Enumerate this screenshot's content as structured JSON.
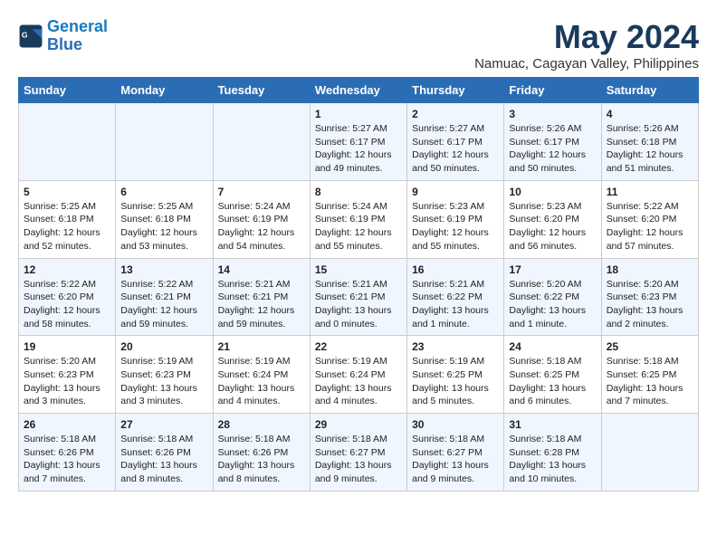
{
  "logo": {
    "line1": "General",
    "line2": "Blue"
  },
  "title": "May 2024",
  "subtitle": "Namuac, Cagayan Valley, Philippines",
  "headers": [
    "Sunday",
    "Monday",
    "Tuesday",
    "Wednesday",
    "Thursday",
    "Friday",
    "Saturday"
  ],
  "weeks": [
    [
      {
        "day": "",
        "info": ""
      },
      {
        "day": "",
        "info": ""
      },
      {
        "day": "",
        "info": ""
      },
      {
        "day": "1",
        "sunrise": "Sunrise: 5:27 AM",
        "sunset": "Sunset: 6:17 PM",
        "daylight": "Daylight: 12 hours and 49 minutes."
      },
      {
        "day": "2",
        "sunrise": "Sunrise: 5:27 AM",
        "sunset": "Sunset: 6:17 PM",
        "daylight": "Daylight: 12 hours and 50 minutes."
      },
      {
        "day": "3",
        "sunrise": "Sunrise: 5:26 AM",
        "sunset": "Sunset: 6:17 PM",
        "daylight": "Daylight: 12 hours and 50 minutes."
      },
      {
        "day": "4",
        "sunrise": "Sunrise: 5:26 AM",
        "sunset": "Sunset: 6:18 PM",
        "daylight": "Daylight: 12 hours and 51 minutes."
      }
    ],
    [
      {
        "day": "5",
        "sunrise": "Sunrise: 5:25 AM",
        "sunset": "Sunset: 6:18 PM",
        "daylight": "Daylight: 12 hours and 52 minutes."
      },
      {
        "day": "6",
        "sunrise": "Sunrise: 5:25 AM",
        "sunset": "Sunset: 6:18 PM",
        "daylight": "Daylight: 12 hours and 53 minutes."
      },
      {
        "day": "7",
        "sunrise": "Sunrise: 5:24 AM",
        "sunset": "Sunset: 6:19 PM",
        "daylight": "Daylight: 12 hours and 54 minutes."
      },
      {
        "day": "8",
        "sunrise": "Sunrise: 5:24 AM",
        "sunset": "Sunset: 6:19 PM",
        "daylight": "Daylight: 12 hours and 55 minutes."
      },
      {
        "day": "9",
        "sunrise": "Sunrise: 5:23 AM",
        "sunset": "Sunset: 6:19 PM",
        "daylight": "Daylight: 12 hours and 55 minutes."
      },
      {
        "day": "10",
        "sunrise": "Sunrise: 5:23 AM",
        "sunset": "Sunset: 6:20 PM",
        "daylight": "Daylight: 12 hours and 56 minutes."
      },
      {
        "day": "11",
        "sunrise": "Sunrise: 5:22 AM",
        "sunset": "Sunset: 6:20 PM",
        "daylight": "Daylight: 12 hours and 57 minutes."
      }
    ],
    [
      {
        "day": "12",
        "sunrise": "Sunrise: 5:22 AM",
        "sunset": "Sunset: 6:20 PM",
        "daylight": "Daylight: 12 hours and 58 minutes."
      },
      {
        "day": "13",
        "sunrise": "Sunrise: 5:22 AM",
        "sunset": "Sunset: 6:21 PM",
        "daylight": "Daylight: 12 hours and 59 minutes."
      },
      {
        "day": "14",
        "sunrise": "Sunrise: 5:21 AM",
        "sunset": "Sunset: 6:21 PM",
        "daylight": "Daylight: 12 hours and 59 minutes."
      },
      {
        "day": "15",
        "sunrise": "Sunrise: 5:21 AM",
        "sunset": "Sunset: 6:21 PM",
        "daylight": "Daylight: 13 hours and 0 minutes."
      },
      {
        "day": "16",
        "sunrise": "Sunrise: 5:21 AM",
        "sunset": "Sunset: 6:22 PM",
        "daylight": "Daylight: 13 hours and 1 minute."
      },
      {
        "day": "17",
        "sunrise": "Sunrise: 5:20 AM",
        "sunset": "Sunset: 6:22 PM",
        "daylight": "Daylight: 13 hours and 1 minute."
      },
      {
        "day": "18",
        "sunrise": "Sunrise: 5:20 AM",
        "sunset": "Sunset: 6:23 PM",
        "daylight": "Daylight: 13 hours and 2 minutes."
      }
    ],
    [
      {
        "day": "19",
        "sunrise": "Sunrise: 5:20 AM",
        "sunset": "Sunset: 6:23 PM",
        "daylight": "Daylight: 13 hours and 3 minutes."
      },
      {
        "day": "20",
        "sunrise": "Sunrise: 5:19 AM",
        "sunset": "Sunset: 6:23 PM",
        "daylight": "Daylight: 13 hours and 3 minutes."
      },
      {
        "day": "21",
        "sunrise": "Sunrise: 5:19 AM",
        "sunset": "Sunset: 6:24 PM",
        "daylight": "Daylight: 13 hours and 4 minutes."
      },
      {
        "day": "22",
        "sunrise": "Sunrise: 5:19 AM",
        "sunset": "Sunset: 6:24 PM",
        "daylight": "Daylight: 13 hours and 4 minutes."
      },
      {
        "day": "23",
        "sunrise": "Sunrise: 5:19 AM",
        "sunset": "Sunset: 6:25 PM",
        "daylight": "Daylight: 13 hours and 5 minutes."
      },
      {
        "day": "24",
        "sunrise": "Sunrise: 5:18 AM",
        "sunset": "Sunset: 6:25 PM",
        "daylight": "Daylight: 13 hours and 6 minutes."
      },
      {
        "day": "25",
        "sunrise": "Sunrise: 5:18 AM",
        "sunset": "Sunset: 6:25 PM",
        "daylight": "Daylight: 13 hours and 7 minutes."
      }
    ],
    [
      {
        "day": "26",
        "sunrise": "Sunrise: 5:18 AM",
        "sunset": "Sunset: 6:26 PM",
        "daylight": "Daylight: 13 hours and 7 minutes."
      },
      {
        "day": "27",
        "sunrise": "Sunrise: 5:18 AM",
        "sunset": "Sunset: 6:26 PM",
        "daylight": "Daylight: 13 hours and 8 minutes."
      },
      {
        "day": "28",
        "sunrise": "Sunrise: 5:18 AM",
        "sunset": "Sunset: 6:26 PM",
        "daylight": "Daylight: 13 hours and 8 minutes."
      },
      {
        "day": "29",
        "sunrise": "Sunrise: 5:18 AM",
        "sunset": "Sunset: 6:27 PM",
        "daylight": "Daylight: 13 hours and 9 minutes."
      },
      {
        "day": "30",
        "sunrise": "Sunrise: 5:18 AM",
        "sunset": "Sunset: 6:27 PM",
        "daylight": "Daylight: 13 hours and 9 minutes."
      },
      {
        "day": "31",
        "sunrise": "Sunrise: 5:18 AM",
        "sunset": "Sunset: 6:28 PM",
        "daylight": "Daylight: 13 hours and 10 minutes."
      },
      {
        "day": "",
        "info": ""
      }
    ]
  ]
}
